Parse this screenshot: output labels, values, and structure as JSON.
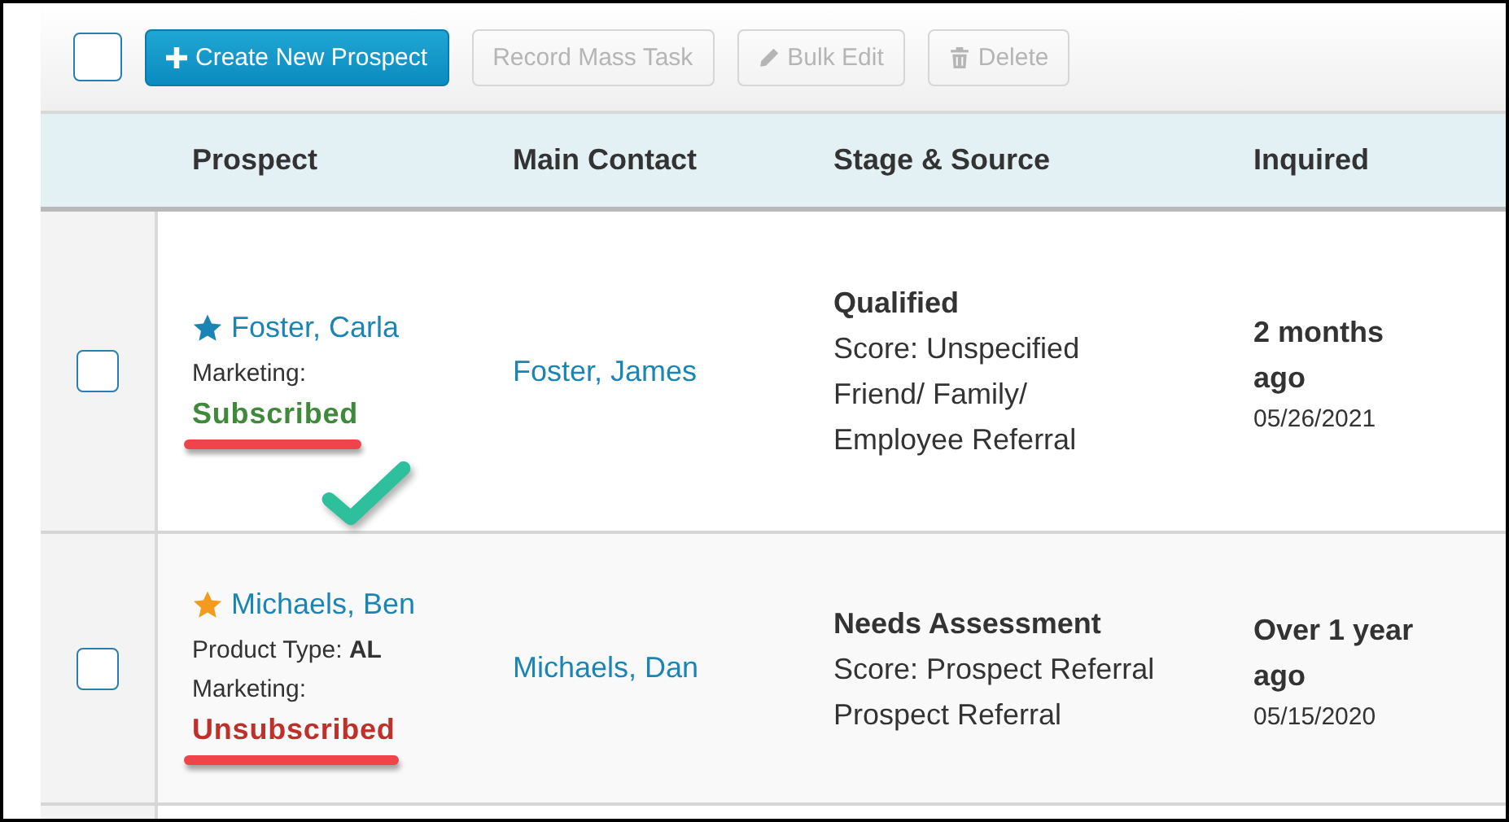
{
  "toolbar": {
    "select_all": {
      "checked": false
    },
    "buttons": [
      {
        "label": "Create New Prospect",
        "kind": "create",
        "disabled": false
      },
      {
        "label": "Record Mass Task",
        "kind": "task",
        "disabled": true
      },
      {
        "label": "Bulk Edit",
        "kind": "edit",
        "disabled": true
      },
      {
        "label": "Delete",
        "kind": "delete",
        "disabled": true
      }
    ]
  },
  "table": {
    "columns": [
      "Prospect",
      "Main Contact",
      "Stage & Source",
      "Inquired"
    ],
    "rows": [
      {
        "checked": false,
        "color": "#1a85b5",
        "prospect": "Foster, Carla",
        "details": [],
        "marketing_label": "Marketing:",
        "marketing_status": "Subscribed",
        "subscribed": true,
        "underlined": true,
        "check_mark": true,
        "main_contact": "Foster, James",
        "stage": "Qualified",
        "source_lines": [
          "Score: Unspecified",
          "Friend/ Family/",
          "Employee Referral"
        ],
        "inquired_lines": [
          "2 months",
          "ago"
        ],
        "inquired_date": "05/26/2021"
      },
      {
        "checked": false,
        "color": "#f39a1f",
        "prospect": "Michaels, Ben",
        "details": [
          "Product Type: **AL**"
        ],
        "marketing_label": "Marketing:",
        "marketing_status": "Unsubscribed",
        "subscribed": false,
        "underlined": true,
        "check_mark": false,
        "main_contact": "Michaels, Dan",
        "stage": "Needs Assessment",
        "source_lines": [
          "Score: Prospect Referral",
          "Prospect Referral"
        ],
        "inquired_lines": [
          "Over 1 year",
          "ago"
        ],
        "inquired_date": "05/15/2020"
      }
    ]
  }
}
